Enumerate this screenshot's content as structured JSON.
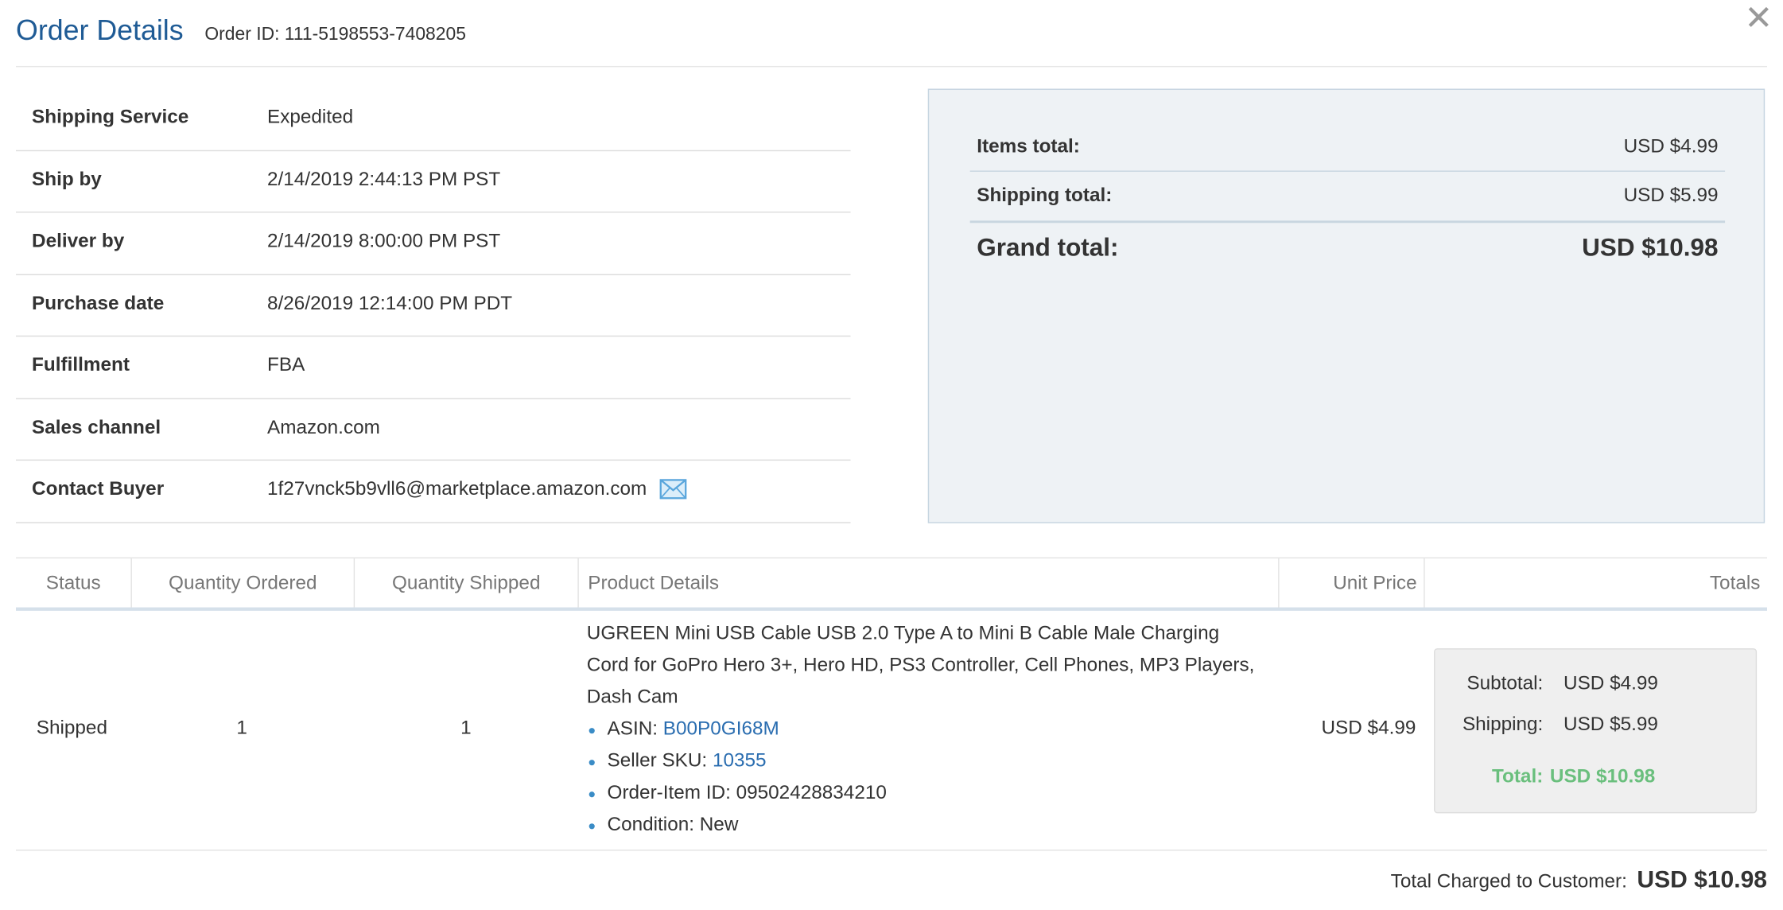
{
  "header": {
    "title": "Order Details",
    "order_id": "Order ID: 111-5198553-7408205",
    "close_glyph": "✕"
  },
  "info": [
    {
      "label": "Shipping Service",
      "value": "Expedited"
    },
    {
      "label": "Ship by",
      "value": "2/14/2019 2:44:13 PM PST"
    },
    {
      "label": "Deliver by",
      "value": "2/14/2019 8:00:00 PM PST"
    },
    {
      "label": "Purchase date",
      "value": "8/26/2019 12:14:00 PM PDT"
    },
    {
      "label": "Fulfillment",
      "value": "FBA"
    },
    {
      "label": "Sales channel",
      "value": "Amazon.com"
    },
    {
      "label": "Contact Buyer",
      "value": "1f27vnck5b9vll6@marketplace.amazon.com",
      "icon": "envelope-icon"
    }
  ],
  "totals": {
    "items_label": "Items total:",
    "items_value": "USD $4.99",
    "shipping_label": "Shipping total:",
    "shipping_value": "USD $5.99",
    "grand_label": "Grand total:",
    "grand_value": "USD $10.98"
  },
  "table": {
    "headers": [
      "Status",
      "Quantity Ordered",
      "Quantity Shipped",
      "Product Details",
      "Unit Price",
      "Totals"
    ],
    "row": {
      "status": "Shipped",
      "qty_ordered": "1",
      "qty_shipped": "1",
      "product_title": "UGREEN Mini USB Cable USB 2.0 Type A to Mini B Cable Male Charging Cord for GoPro Hero 3+, Hero HD, PS3 Controller, Cell Phones, MP3 Players, Dash Cam",
      "asin_label": "ASIN:",
      "asin_value": "B00P0GI68M",
      "sku_label": "Seller SKU:",
      "sku_value": "10355",
      "order_item": "Order-Item ID: 09502428834210",
      "condition": "Condition: New",
      "unit_price": "USD $4.99",
      "subtotal_label": "Subtotal:",
      "subtotal_value": "USD $4.99",
      "shipping_label": "Shipping:",
      "shipping_value": "USD $5.99",
      "total_label": "Total:",
      "total_value": "USD $10.98"
    }
  },
  "footer": {
    "charged_label": "Total Charged to Customer:",
    "charged_value": "USD $10.98"
  },
  "colors": {
    "title": "#1f5b95",
    "link": "#2a6db0",
    "total_green": "#6abf7d",
    "summary_bg": "#eef2f5"
  }
}
